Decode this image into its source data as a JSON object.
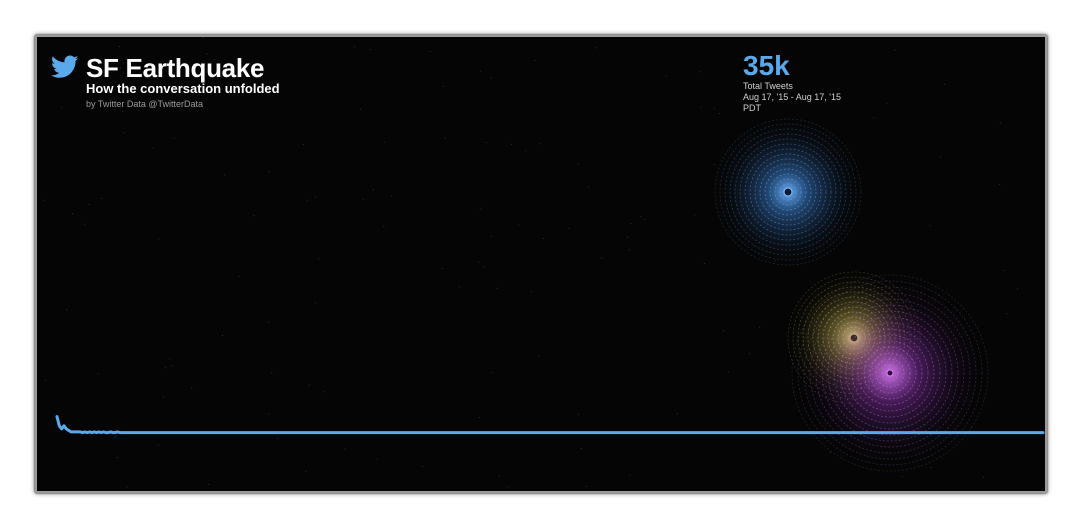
{
  "header": {
    "title": "SF Earthquake",
    "subtitle": "How the conversation unfolded",
    "byline": "by Twitter Data @TwitterData"
  },
  "stats": {
    "total_value": "35k",
    "total_label": "Total Tweets",
    "date_range": "Aug 17, '15 - Aug 17, '15",
    "timezone": "PDT"
  },
  "colors": {
    "background": "#050505",
    "line": "#5aa9ea",
    "accent_blue": "#4a90e2",
    "accent_yellow": "#d8d04a",
    "accent_purple": "#b24ad8"
  },
  "icons": {
    "logo": "twitter-bird-icon"
  },
  "chart_data": {
    "type": "line",
    "xlabel": "",
    "ylabel": "",
    "grid": false,
    "ylim": [
      0,
      100
    ],
    "series": [
      {
        "values": [
          6,
          3,
          2,
          3,
          2,
          1.5,
          1,
          1,
          1,
          1,
          1,
          0.8,
          1,
          0.8,
          1,
          0.8,
          1,
          0.8,
          1,
          0.8,
          1,
          0.8,
          0.8,
          1,
          0.8,
          0.8,
          1,
          0.8,
          0.8,
          0.8,
          0.8,
          0.8,
          0.8,
          0.8,
          0.8,
          0.8,
          0.8,
          0.8,
          0.8,
          0.8,
          0.8,
          0.8,
          0.8,
          0.8,
          0.8,
          0.8,
          0.8,
          0.8,
          0.8,
          0.8,
          0.8,
          0.8,
          0.8,
          0.8,
          0.8,
          0.8,
          0.8,
          0.8,
          0.8,
          0.8,
          0.8,
          0.8,
          0.8,
          0.8,
          0.8,
          0.8,
          0.8,
          0.8,
          0.8,
          0.8,
          0.8,
          0.8,
          0.8,
          0.8,
          0.8,
          0.8,
          0.8,
          0.8,
          0.8,
          0.8,
          0.8,
          0.8,
          0.8,
          0.8,
          0.8,
          0.8,
          0.8,
          0.8,
          0.8,
          0.8,
          0.8,
          0.8,
          0.8,
          0.8,
          0.8,
          0.8,
          0.8,
          0.8,
          0.8,
          0.8,
          0.8,
          0.8,
          0.8,
          0.8,
          0.8,
          0.8,
          0.8,
          0.8,
          0.8,
          0.8,
          0.8,
          0.8,
          0.8,
          0.8,
          0.8,
          0.8,
          0.8,
          0.8,
          0.8,
          0.8,
          0.8,
          0.8,
          0.8,
          0.8,
          0.8,
          0.8,
          0.8,
          0.8,
          0.8,
          0.8,
          0.8,
          0.8,
          0.8,
          0.8,
          0.8,
          0.8,
          0.8,
          0.8,
          0.8,
          0.8,
          0.8,
          0.8,
          0.8,
          0.8,
          0.8,
          0.8,
          0.8,
          0.8,
          0.8,
          0.8,
          0.8,
          0.8,
          0.8,
          0.8,
          0.8,
          0.8,
          0.8,
          0.8,
          0.8,
          0.8,
          0.8,
          0.8,
          0.8,
          0.8,
          0.8,
          0.8,
          0.8,
          0.8,
          0.8,
          0.8,
          0.8,
          0.8,
          0.8,
          0.8,
          0.8,
          0.8,
          0.8,
          0.8,
          0.8,
          0.8,
          0.8,
          0.8,
          0.8,
          0.8,
          0.8,
          0.8,
          0.8,
          0.8,
          0.8,
          0.8,
          0.8,
          0.8,
          0.8,
          0.8,
          0.8,
          0.8,
          0.8,
          0.8,
          0.8,
          0.8,
          0.8,
          0.8,
          0.8,
          0.8,
          0.8,
          0.8,
          0.8,
          0.8,
          0.8,
          0.8,
          0.8,
          0.8,
          0.8,
          0.8,
          0.8,
          0.8,
          0.8,
          0.8,
          0.8,
          0.8,
          0.8,
          0.8,
          0.8,
          0.8,
          0.8,
          0.8,
          0.8,
          0.8,
          0.8,
          0.8,
          0.8,
          0.8,
          0.8,
          0.8,
          0.8,
          0.8,
          0.8,
          0.8,
          0.8,
          0.8,
          0.8,
          0.8,
          0.8,
          0.8,
          0.8,
          0.8,
          0.8,
          0.8,
          0.8,
          0.8,
          0.8,
          0.8,
          0.8,
          0.8,
          0.8,
          0.8,
          0.8,
          0.8,
          0.8,
          0.8,
          0.8,
          0.8,
          0.8,
          0.8,
          0.8,
          0.8,
          0.8,
          0.8,
          0.8,
          0.8,
          0.8,
          0.8,
          0.8,
          0.8,
          0.8,
          0.8,
          0.8,
          0.8,
          0.8,
          0.8,
          0.8,
          0.8,
          0.8,
          0.8,
          0.8,
          0.8,
          0.8,
          0.8,
          0.8,
          0.8,
          0.8,
          0.8,
          0.8,
          0.8,
          0.8,
          0.8,
          0.8,
          0.8,
          0.8,
          0.8,
          0.8,
          0.8,
          0.8,
          0.8,
          0.8,
          0.8,
          0.8,
          0.8,
          0.8,
          0.8,
          0.8,
          0.8,
          0.8,
          0.8,
          0.8,
          0.8,
          0.8,
          0.8,
          0.8,
          0.8,
          0.8,
          0.8,
          0.8,
          0.8,
          0.8,
          0.8,
          0.8,
          0.8,
          0.8,
          0.8,
          0.8,
          0.8,
          0.8,
          0.8,
          0.8,
          0.8,
          0.8,
          0.8,
          0.8,
          0.8,
          0.8,
          0.8,
          0.8,
          0.8,
          0.8,
          0.8,
          0.8,
          0.8,
          0.8,
          0.8,
          0.8,
          0.8,
          0.8,
          0.8,
          0.8,
          0.8,
          0.8,
          0.8,
          0.8,
          0.8,
          0.8,
          0.8,
          0.8,
          0.8,
          0.8,
          0.8,
          0.8,
          0.8,
          0.8,
          0.8,
          0.8,
          0.8,
          0.8,
          0.8,
          0.8,
          0.8,
          0.8,
          0.8,
          0.8,
          0.8,
          0.8,
          0.8,
          0.8,
          0.8,
          0.8,
          0.8,
          0.8,
          0.8,
          0.8,
          0.8,
          0.8,
          0.8,
          0.8,
          0.8,
          0.8,
          0.8,
          0.8,
          0.8,
          0.8,
          0.8,
          0.8,
          0.8,
          0.8,
          0.8,
          0.8,
          0.8,
          0.8,
          0.8,
          0.8,
          0.8,
          0.8,
          0.8,
          0.8,
          0.8,
          0.8,
          0.8,
          0.8,
          0.8,
          0.8,
          0.8,
          0.8,
          0.8,
          0.8,
          0.8,
          0.8
        ]
      }
    ]
  }
}
